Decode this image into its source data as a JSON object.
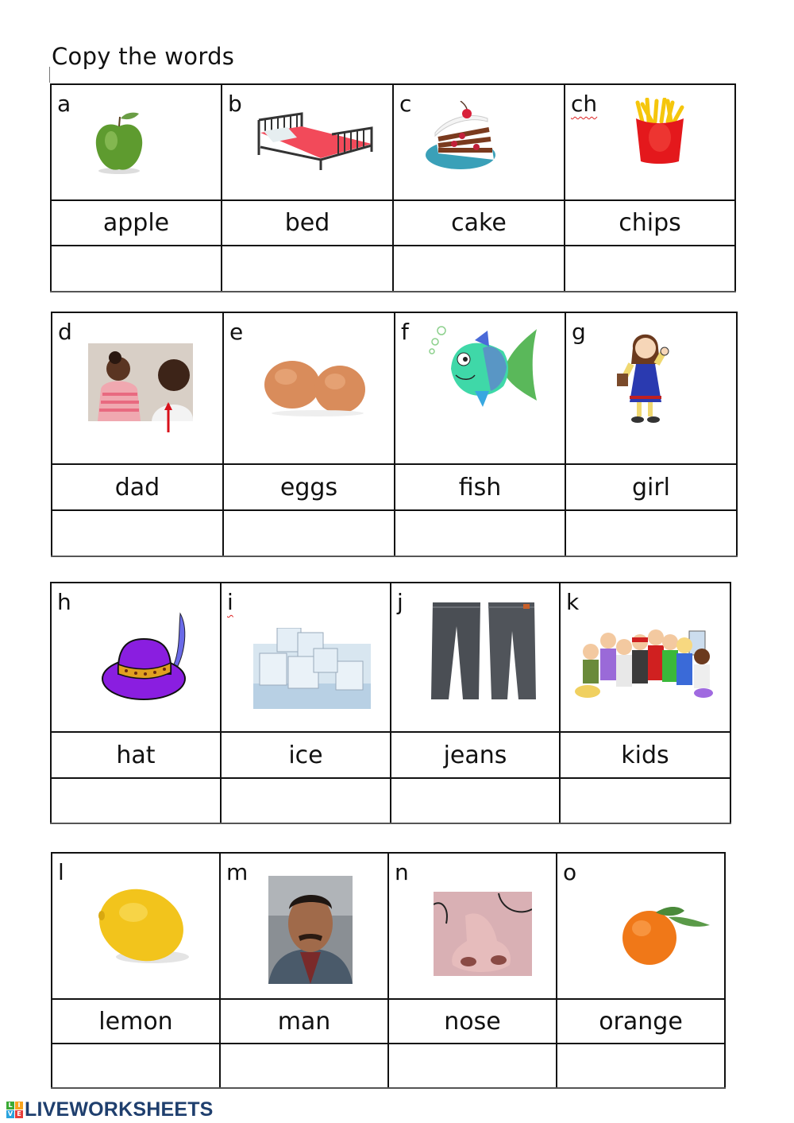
{
  "title": "Copy the words",
  "sections": [
    {
      "items": [
        {
          "letter": "a",
          "word": "apple",
          "image": "green-apple"
        },
        {
          "letter": "b",
          "word": "bed",
          "image": "red-bed"
        },
        {
          "letter": "c",
          "word": "cake",
          "image": "cake-slice"
        },
        {
          "letter": "ch",
          "word": "chips",
          "image": "french-fries",
          "letter_spellcheck": true
        }
      ]
    },
    {
      "items": [
        {
          "letter": "d",
          "word": "dad",
          "image": "father-and-daughter-photo"
        },
        {
          "letter": "e",
          "word": "eggs",
          "image": "two-brown-eggs"
        },
        {
          "letter": "f",
          "word": "fish",
          "image": "cartoon-fish"
        },
        {
          "letter": "g",
          "word": "girl",
          "image": "cartoon-girl"
        }
      ]
    },
    {
      "items": [
        {
          "letter": "h",
          "word": "hat",
          "image": "purple-feathered-hat"
        },
        {
          "letter": "i",
          "word": "ice",
          "image": "ice-cubes"
        },
        {
          "letter": "j",
          "word": "jeans",
          "image": "pair-of-jeans"
        },
        {
          "letter": "k",
          "word": "kids",
          "image": "group-of-kids"
        }
      ]
    },
    {
      "items": [
        {
          "letter": "l",
          "word": "lemon",
          "image": "lemon"
        },
        {
          "letter": "m",
          "word": "man",
          "image": "man-portrait"
        },
        {
          "letter": "n",
          "word": "nose",
          "image": "nose-closeup"
        },
        {
          "letter": "o",
          "word": "orange",
          "image": "orange-fruit"
        }
      ]
    }
  ],
  "footer": {
    "logo_blocks": [
      "L",
      "I",
      "V",
      "E"
    ],
    "logo_text": "LIVEWORKSHEETS",
    "logo_colors": [
      "#3aaa35",
      "#f7a21b",
      "#29a3dd",
      "#e83e3a"
    ],
    "text_color": "#1f3f6e"
  }
}
